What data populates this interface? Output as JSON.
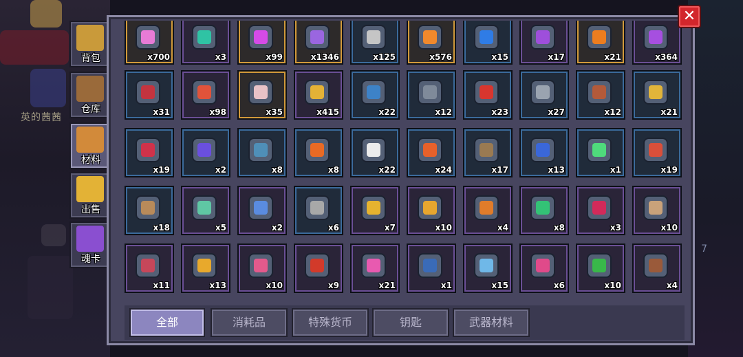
{
  "colors": {
    "panel": "#47455f",
    "panel_border": "#8c8aa6",
    "slot": "#242b3b",
    "active_tab": "#8c86bf",
    "close": "#d2262c"
  },
  "background": {
    "player_name_fragment": "英的茜茜",
    "side_number": "7"
  },
  "close_button": {
    "label": "✕"
  },
  "side_tabs": [
    {
      "label": "背包",
      "icon": "backpack-icon",
      "active": false
    },
    {
      "label": "仓库",
      "icon": "chest-icon",
      "active": false
    },
    {
      "label": "材料",
      "icon": "materials-icon",
      "active": true
    },
    {
      "label": "出售",
      "icon": "gold-coins-icon",
      "active": false
    },
    {
      "label": "魂卡",
      "icon": "soul-card-icon",
      "active": false
    }
  ],
  "category_tabs": [
    {
      "label": "全部",
      "active": true
    },
    {
      "label": "消耗品",
      "active": false
    },
    {
      "label": "特殊货币",
      "active": false
    },
    {
      "label": "钥匙",
      "active": false
    },
    {
      "label": "武器材料",
      "active": false
    }
  ],
  "items": [
    [
      {
        "icon": "pink-gem-icon",
        "count": "x700",
        "color": "#e77bd6",
        "frame": "gold"
      },
      {
        "icon": "teal-coin-icon",
        "count": "x3",
        "color": "#2fc3a4",
        "frame": "purple"
      },
      {
        "icon": "magenta-crystal-icon",
        "count": "x99",
        "color": "#d54be8",
        "frame": "gold"
      },
      {
        "icon": "purple-flame-icon",
        "count": "x1346",
        "color": "#9a66e0",
        "frame": "gold"
      },
      {
        "icon": "silver-ore-icon",
        "count": "x125",
        "color": "#c5c5c5",
        "frame": "blue"
      },
      {
        "icon": "orange-ore-icon",
        "count": "x576",
        "color": "#f0892c",
        "frame": "gold"
      },
      {
        "icon": "blue-key-icon",
        "count": "x15",
        "color": "#2f7ce6",
        "frame": "blue"
      },
      {
        "icon": "purple-key-icon",
        "count": "x17",
        "color": "#9e4fdb",
        "frame": "purple"
      },
      {
        "icon": "orange-key-icon",
        "count": "x21",
        "color": "#ec7d1f",
        "frame": "gold"
      },
      {
        "icon": "purple-token-icon",
        "count": "x364",
        "color": "#a64fe0",
        "frame": "purple"
      }
    ],
    [
      {
        "icon": "red-crystal-icon",
        "count": "x31",
        "color": "#c4343f",
        "frame": "blue"
      },
      {
        "icon": "red-scroll-icon",
        "count": "x98",
        "color": "#e0533a",
        "frame": "purple"
      },
      {
        "icon": "skull-cake-icon",
        "count": "x35",
        "color": "#e8c2c7",
        "frame": "gold"
      },
      {
        "icon": "gold-shield-icon",
        "count": "x415",
        "color": "#e3b236",
        "frame": "purple"
      },
      {
        "icon": "spear-part-icon",
        "count": "x22",
        "color": "#3d82c7",
        "frame": "blue"
      },
      {
        "icon": "gun-barrel-icon",
        "count": "x12",
        "color": "#7f8a9a",
        "frame": "blue"
      },
      {
        "icon": "red-dagger-icon",
        "count": "x23",
        "color": "#d8362f",
        "frame": "blue"
      },
      {
        "icon": "metal-coupler-icon",
        "count": "x27",
        "color": "#9aa3b0",
        "frame": "blue"
      },
      {
        "icon": "rifle-part-icon",
        "count": "x12",
        "color": "#b35a3a",
        "frame": "blue"
      },
      {
        "icon": "gold-horn-icon",
        "count": "x21",
        "color": "#e1b43a",
        "frame": "blue"
      }
    ],
    [
      {
        "icon": "red-blade-icon",
        "count": "x19",
        "color": "#d0324a",
        "frame": "blue"
      },
      {
        "icon": "purple-orb-icon",
        "count": "x2",
        "color": "#6a4fe0",
        "frame": "blue"
      },
      {
        "icon": "coil-part-icon",
        "count": "x8",
        "color": "#4f8fb8",
        "frame": "blue"
      },
      {
        "icon": "orange-block-icon",
        "count": "x8",
        "color": "#e96a24",
        "frame": "blue"
      },
      {
        "icon": "white-blob-icon",
        "count": "x22",
        "color": "#ececec",
        "frame": "blue"
      },
      {
        "icon": "lantern-icon",
        "count": "x24",
        "color": "#e7612a",
        "frame": "blue"
      },
      {
        "icon": "wood-plank-icon",
        "count": "x17",
        "color": "#9a7a52",
        "frame": "blue"
      },
      {
        "icon": "blue-pistol-icon",
        "count": "x13",
        "color": "#3a67d9",
        "frame": "blue"
      },
      {
        "icon": "green-vial-icon",
        "count": "x1",
        "color": "#4fdb7c",
        "frame": "blue"
      },
      {
        "icon": "crescent-blade-icon",
        "count": "x19",
        "color": "#d94f3a",
        "frame": "blue"
      }
    ],
    [
      {
        "icon": "bow-limb-icon",
        "count": "x18",
        "color": "#b88a5a",
        "frame": "blue"
      },
      {
        "icon": "twin-orb-icon",
        "count": "x5",
        "color": "#5fc7a4",
        "frame": "purple"
      },
      {
        "icon": "blue-wrench-icon",
        "count": "x2",
        "color": "#5a8ce0",
        "frame": "purple"
      },
      {
        "icon": "gear-part-icon",
        "count": "x6",
        "color": "#a8a8a8",
        "frame": "blue"
      },
      {
        "icon": "gold-bell-icon",
        "count": "x7",
        "color": "#e6b32f",
        "frame": "purple"
      },
      {
        "icon": "gold-trident-icon",
        "count": "x10",
        "color": "#e6a62f",
        "frame": "purple"
      },
      {
        "icon": "orange-ring-icon",
        "count": "x4",
        "color": "#e07c2a",
        "frame": "purple"
      },
      {
        "icon": "green-eye-icon",
        "count": "x8",
        "color": "#33c276",
        "frame": "purple"
      },
      {
        "icon": "red-whip-icon",
        "count": "x3",
        "color": "#d22a5a",
        "frame": "purple"
      },
      {
        "icon": "horn-shell-icon",
        "count": "x10",
        "color": "#c9a27a",
        "frame": "purple"
      }
    ],
    [
      {
        "icon": "shield-badge-icon",
        "count": "x11",
        "color": "#c6475a",
        "frame": "purple"
      },
      {
        "icon": "power-core-icon",
        "count": "x13",
        "color": "#e8a92c",
        "frame": "purple"
      },
      {
        "icon": "pink-flame-gem-icon",
        "count": "x10",
        "color": "#e35a8c",
        "frame": "purple"
      },
      {
        "icon": "red-portal-icon",
        "count": "x9",
        "color": "#d23a2a",
        "frame": "purple"
      },
      {
        "icon": "magic-wand-icon",
        "count": "x21",
        "color": "#e85ab0",
        "frame": "purple"
      },
      {
        "icon": "blue-barrel-icon",
        "count": "x1",
        "color": "#3a6bb8",
        "frame": "purple"
      },
      {
        "icon": "ice-sword-icon",
        "count": "x15",
        "color": "#6fb8e8",
        "frame": "purple"
      },
      {
        "icon": "pink-crab-icon",
        "count": "x6",
        "color": "#e04a8a",
        "frame": "purple"
      },
      {
        "icon": "green-rifle-icon",
        "count": "x10",
        "color": "#39b84a",
        "frame": "purple"
      },
      {
        "icon": "brown-crossbow-icon",
        "count": "x4",
        "color": "#9a5a3a",
        "frame": "purple"
      }
    ]
  ]
}
